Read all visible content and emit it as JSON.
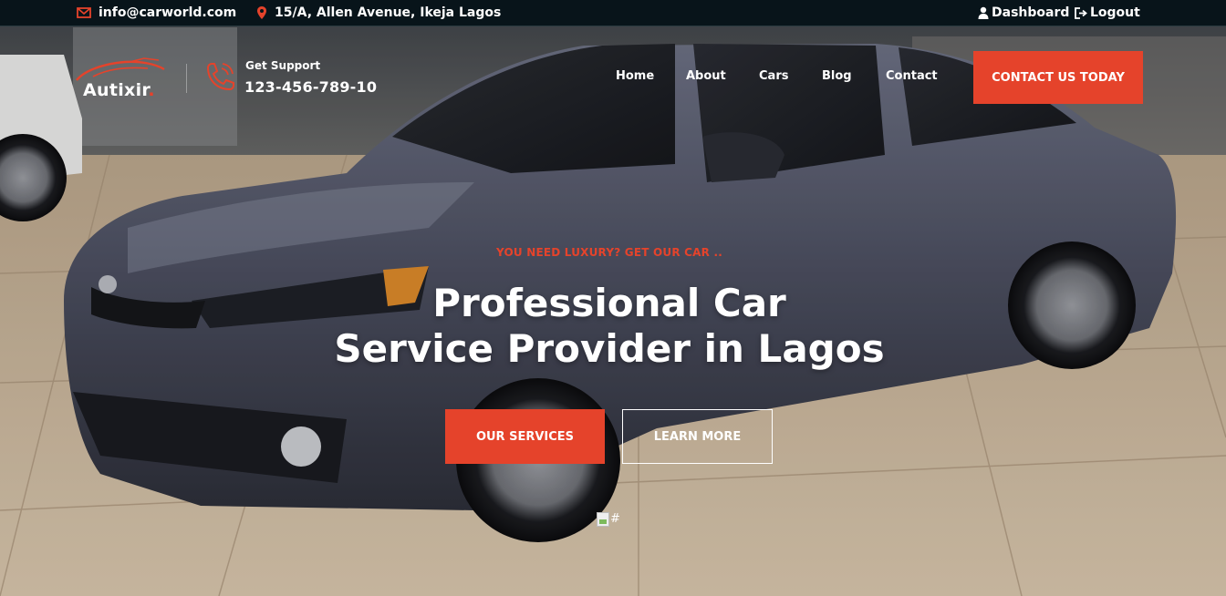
{
  "topbar": {
    "email": "info@carworld.com",
    "address": "15/A, Allen Avenue, Ikeja Lagos",
    "dashboard": "Dashboard",
    "logout": "Logout",
    "icons": {
      "email": "envelope-icon",
      "address": "map-pin-icon",
      "dashboard": "user-icon",
      "logout": "sign-out-icon"
    }
  },
  "header": {
    "logo_text": "Autixir",
    "logo_dot": ".",
    "support_label": "Get Support",
    "support_phone": "123-456-789-10",
    "nav": [
      "Home",
      "About",
      "Cars",
      "Blog",
      "Contact"
    ],
    "cta": "CONTACT US TODAY"
  },
  "hero": {
    "subtitle": "YOU NEED LUXURY? GET OUR CAR ..",
    "title_line1": "Professional Car",
    "title_line2": "Service Provider in Lagos",
    "btn_services": "OUR SERVICES",
    "btn_learn": "LEARN MORE",
    "broken_image_alt": "#"
  },
  "colors": {
    "accent": "#e5432b",
    "topbar_bg": "#08141a",
    "text": "#ffffff"
  }
}
